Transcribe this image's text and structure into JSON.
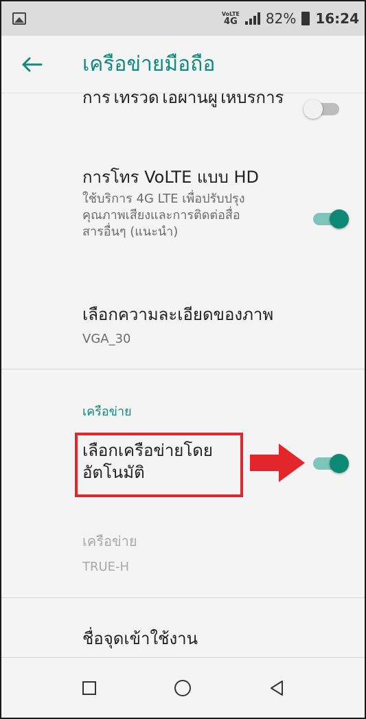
{
  "status_bar": {
    "volte_label": "VoLTE",
    "network_type": "4G",
    "battery_percent": "82%",
    "time": "16:24",
    "icons": [
      "image-notification-icon",
      "signal-icon",
      "battery-icon"
    ]
  },
  "app_bar": {
    "title": "เครือข่ายมือถือ",
    "back_icon": "arrow-left-icon"
  },
  "settings": {
    "wifi_calling": {
      "title": "การโทรวิดีโอผ่านผู้ให้บริการ",
      "enabled": false
    },
    "volte_hd": {
      "title": "การโทร VoLTE แบบ HD",
      "subtitle": "ใช้บริการ 4G LTE เพื่อปรับปรุงคุณภาพเสียงและการติดต่อสื่อสารอื่นๆ (แนะนำ)",
      "enabled": true
    },
    "video_resolution": {
      "title": "เลือกความละเอียดของภาพ",
      "value": "VGA_30"
    },
    "network_section": {
      "header": "เครือข่าย"
    },
    "auto_network": {
      "title": "เลือกเครือข่ายโดยอัตโนมัติ",
      "enabled": true
    },
    "network": {
      "title": "เครือข่าย",
      "value": "TRUE-H",
      "disabled": true
    },
    "apn": {
      "title": "ชื่อจุดเข้าใช้งาน"
    }
  },
  "nav_bar": {
    "icons": [
      "recents-square-icon",
      "home-circle-icon",
      "back-triangle-icon"
    ]
  },
  "colors": {
    "accent": "#128a7b",
    "toggle_on": "#0d8a75",
    "highlight": "#e3262c"
  }
}
